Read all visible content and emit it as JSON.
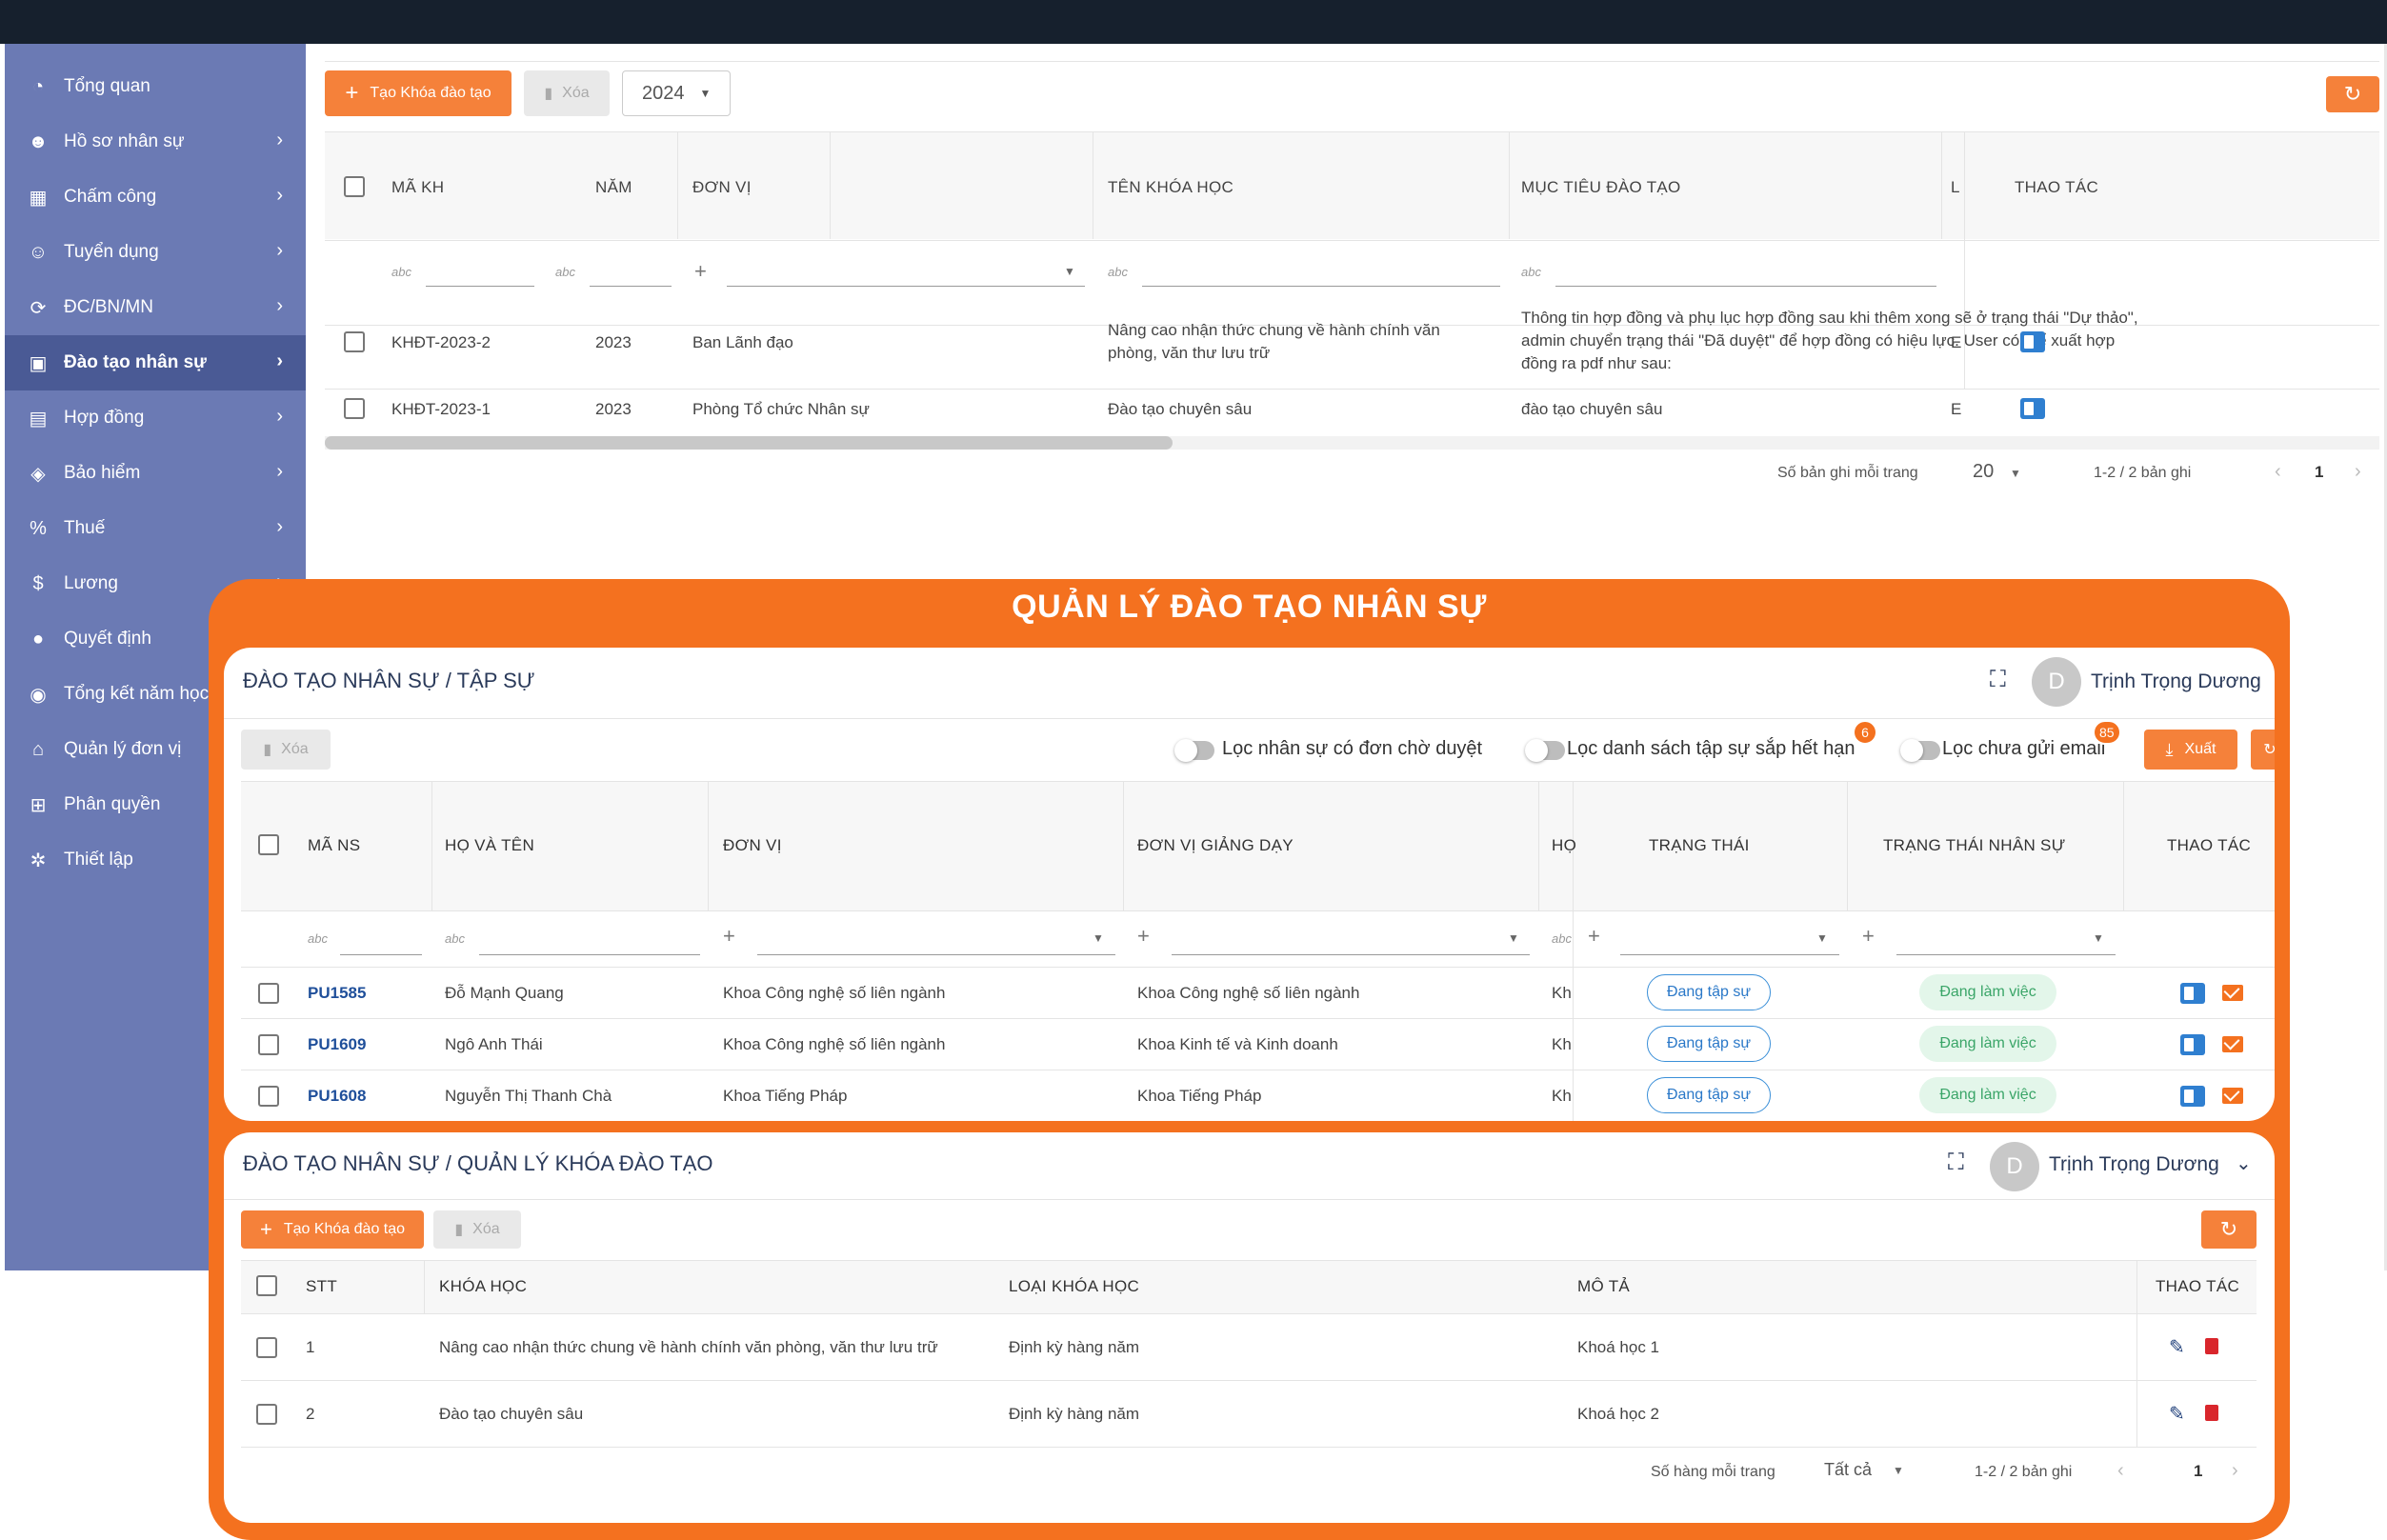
{
  "sidebar": {
    "items": [
      {
        "label": "Tổng quan",
        "icon": "pie-chart-icon",
        "symbol": "◔",
        "chevron": false
      },
      {
        "label": "Hồ sơ nhân sự",
        "icon": "people-icon",
        "symbol": "☻",
        "chevron": true
      },
      {
        "label": "Chấm công",
        "icon": "calendar-icon",
        "symbol": "▦",
        "chevron": true
      },
      {
        "label": "Tuyển dụng",
        "icon": "user-icon",
        "symbol": "☺",
        "chevron": true
      },
      {
        "label": "ĐC/BN/MN",
        "icon": "sync-icon",
        "symbol": "⟳",
        "chevron": true
      },
      {
        "label": "Đào tạo nhân sự",
        "icon": "training-icon",
        "symbol": "▣",
        "chevron": true,
        "active": true
      },
      {
        "label": "Hợp đồng",
        "icon": "contract-icon",
        "symbol": "▤",
        "chevron": true
      },
      {
        "label": "Bảo hiểm",
        "icon": "shield-icon",
        "symbol": "◈",
        "chevron": true
      },
      {
        "label": "Thuế",
        "icon": "percent-icon",
        "symbol": "%",
        "chevron": true
      },
      {
        "label": "Lương",
        "icon": "dollar-icon",
        "symbol": "$",
        "chevron": true
      },
      {
        "label": "Quyết định",
        "icon": "bulb-icon",
        "symbol": "●",
        "chevron": false
      },
      {
        "label": "Tổng kết năm học",
        "icon": "summary-icon",
        "symbol": "◉",
        "chevron": false
      },
      {
        "label": "Quản lý đơn vị",
        "icon": "home-icon",
        "symbol": "⌂",
        "chevron": false
      },
      {
        "label": "Phân quyền",
        "icon": "org-icon",
        "symbol": "⊞",
        "chevron": false
      },
      {
        "label": "Thiết lập",
        "icon": "gear-icon",
        "symbol": "✲",
        "chevron": false
      }
    ]
  },
  "bg": {
    "create_label": "Tạo Khóa đào tạo",
    "delete_label": "Xóa",
    "year_value": "2024",
    "headers": {
      "ma": "MÃ KH",
      "nam": "NĂM",
      "don_vi": "ĐƠN VỊ",
      "ten": "TÊN KHÓA HỌC",
      "muc_tieu": "MỤC TIÊU ĐÀO TẠO",
      "cut": "L",
      "thao_tac": "THAO TÁC"
    },
    "rows": [
      {
        "ma": "KHĐT-2023-2",
        "nam": "2023",
        "don_vi": "Ban Lãnh đạo",
        "ten1": "Nâng cao nhận thức chung về hành chính văn",
        "ten2": "phòng, văn thư lưu trữ",
        "mt1": "Thông tin hợp đồng và phụ lục hợp đồng sau khi thêm xong sẽ ở trạng thái \"Dự thảo\",",
        "mt2": "admin chuyển trạng thái \"Đã duyệt\" để hợp đồng có hiệu lực. User có thể xuất hợp",
        "mt3": "đồng ra pdf như sau:",
        "cut": "E"
      },
      {
        "ma": "KHĐT-2023-1",
        "nam": "2023",
        "don_vi": "Phòng Tổ chức Nhân sự",
        "ten1": "Đào tạo chuyên sâu",
        "mt1": "đào tạo chuyên sâu",
        "cut": "E"
      }
    ],
    "pager": {
      "per_page_label": "Số bản ghi mỗi trang",
      "per_page": "20",
      "range": "1-2 / 2 bản ghi",
      "page": "1"
    }
  },
  "overlay": {
    "title": "QUẢN LÝ ĐÀO TẠO NHÂN SỰ"
  },
  "panel1": {
    "title": "ĐÀO TẠO NHÂN SỰ / TẬP SỰ",
    "user": {
      "initial": "D",
      "name": "Trịnh Trọng Dương"
    },
    "delete_label": "Xóa",
    "filters": [
      {
        "label": "Lọc nhân sự có đơn chờ duyệt"
      },
      {
        "label": "Lọc danh sách tập sự sắp hết hạn",
        "badge": "6"
      },
      {
        "label": "Lọc chưa gửi email",
        "badge": "85"
      }
    ],
    "export_label": "Xuất",
    "headers": {
      "ma": "MÃ NS",
      "ho_ten": "HỌ VÀ TÊN",
      "don_vi": "ĐƠN VỊ",
      "gd": "ĐƠN VỊ GIẢNG DẠY",
      "cut": "HỌ",
      "tt": "TRẠNG THÁI",
      "ttns": "TRẠNG THÁI NHÂN SỰ",
      "thao_tac": "THAO TÁC"
    },
    "rows": [
      {
        "ma": "PU1585",
        "ho_ten": "Đỗ Mạnh Quang",
        "don_vi": "Khoa Công nghệ số liên ngành",
        "gd": "Khoa Công nghệ số liên ngành",
        "cut": "Kh",
        "tt": "Đang tập sự",
        "ttns": "Đang làm việc"
      },
      {
        "ma": "PU1609",
        "ho_ten": "Ngô Anh Thái",
        "don_vi": "Khoa Công nghệ số liên ngành",
        "gd": "Khoa Kinh tế và Kinh doanh",
        "cut": "Kh",
        "tt": "Đang tập sự",
        "ttns": "Đang làm việc"
      },
      {
        "ma": "PU1608",
        "ho_ten": "Nguyễn Thị Thanh Chà",
        "don_vi": "Khoa Tiếng Pháp",
        "gd": "Khoa Tiếng Pháp",
        "cut": "Kh",
        "tt": "Đang tập sự",
        "ttns": "Đang làm việc"
      }
    ]
  },
  "panel2": {
    "title": "ĐÀO TẠO NHÂN SỰ / QUẢN LÝ KHÓA ĐÀO TẠO",
    "user": {
      "initial": "D",
      "name": "Trịnh Trọng Dương"
    },
    "create_label": "Tạo Khóa đào tạo",
    "delete_label": "Xóa",
    "headers": {
      "stt": "STT",
      "khoa_hoc": "KHÓA HỌC",
      "loai": "LOẠI KHÓA HỌC",
      "mo_ta": "MÔ TẢ",
      "thao_tac": "THAO TÁC"
    },
    "rows": [
      {
        "stt": "1",
        "khoa_hoc": "Nâng cao nhận thức chung về hành chính văn phòng, văn thư lưu trữ",
        "loai": "Định kỳ hàng năm",
        "mo_ta": "Khoá học 1"
      },
      {
        "stt": "2",
        "khoa_hoc": "Đào tạo chuyên sâu",
        "loai": "Định kỳ hàng năm",
        "mo_ta": "Khoá học 2"
      }
    ],
    "pager": {
      "per_page_label": "Số hàng mỗi trang",
      "per_page": "Tất cả",
      "range": "1-2 / 2 bản ghi",
      "page": "1"
    }
  },
  "colors": {
    "accent": "#f4711f",
    "sidebar": "#6b7ab4",
    "sidebar_active": "#4a5a95",
    "topbar": "#16202d"
  }
}
